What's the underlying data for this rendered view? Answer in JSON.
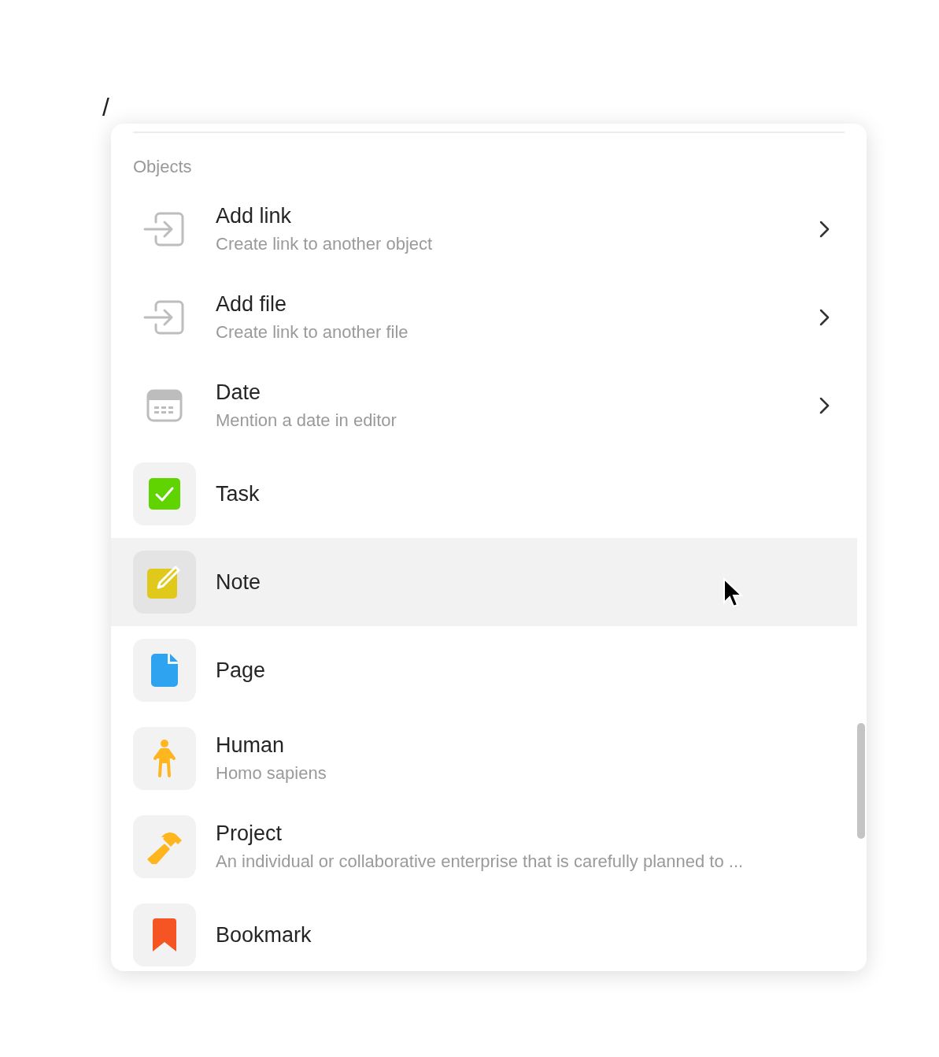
{
  "editor": {
    "text": "/"
  },
  "menu": {
    "section": "Objects",
    "items": [
      {
        "kind": "link",
        "title": "Add link",
        "subtitle": "Create link to another object",
        "has_submenu": true,
        "selected": false
      },
      {
        "kind": "link",
        "title": "Add file",
        "subtitle": "Create link to another file",
        "has_submenu": true,
        "selected": false
      },
      {
        "kind": "date",
        "title": "Date",
        "subtitle": "Mention a date in editor",
        "has_submenu": true,
        "selected": false
      },
      {
        "kind": "task",
        "title": "Task",
        "has_submenu": false,
        "selected": false
      },
      {
        "kind": "note",
        "title": "Note",
        "has_submenu": false,
        "selected": true
      },
      {
        "kind": "page",
        "title": "Page",
        "has_submenu": false,
        "selected": false
      },
      {
        "kind": "human",
        "title": "Human",
        "subtitle": "Homo sapiens",
        "has_submenu": false,
        "selected": false
      },
      {
        "kind": "project",
        "title": "Project",
        "subtitle": "An individual or collaborative enterprise that is carefully planned to ...",
        "has_submenu": false,
        "selected": false
      },
      {
        "kind": "bookmark",
        "title": "Bookmark",
        "has_submenu": false,
        "selected": false
      }
    ]
  }
}
